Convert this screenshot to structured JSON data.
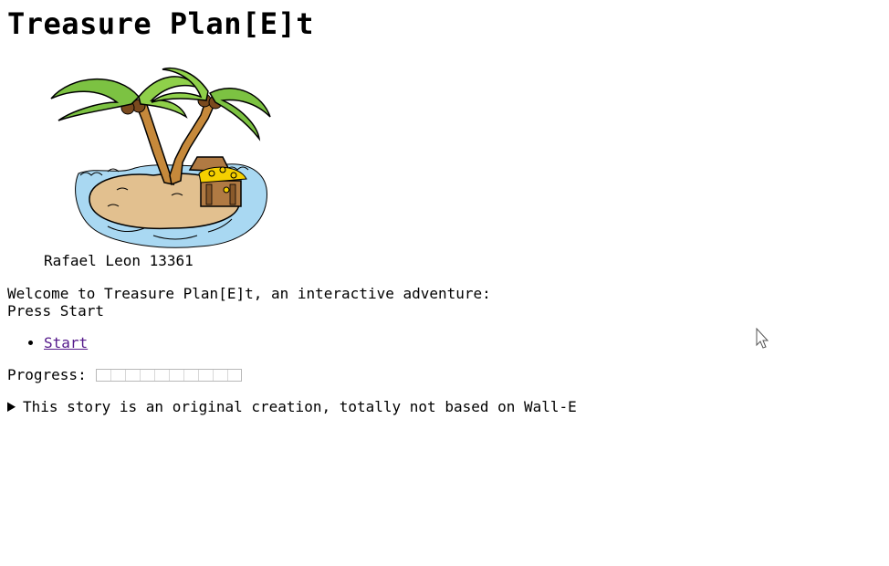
{
  "page": {
    "title": "Treasure Plan[E]t"
  },
  "figure": {
    "image_name": "palm-island-treasure-illustration",
    "caption": "Rafael Leon 13361"
  },
  "intro": {
    "welcome_line": "Welcome to Treasure Plan[E]t, an interactive adventure:",
    "instruction_line": "Press Start"
  },
  "links": [
    {
      "label": "Start"
    }
  ],
  "progress": {
    "label": "Progress:",
    "value": 0
  },
  "details": {
    "summary": "This story is an original creation, totally not based on Wall-E"
  },
  "colors": {
    "link_visited": "#551a8b",
    "water": "#a9d8f2",
    "sand": "#e2c08f",
    "palm_leaf": "#7cc242",
    "trunk": "#c6893b"
  }
}
